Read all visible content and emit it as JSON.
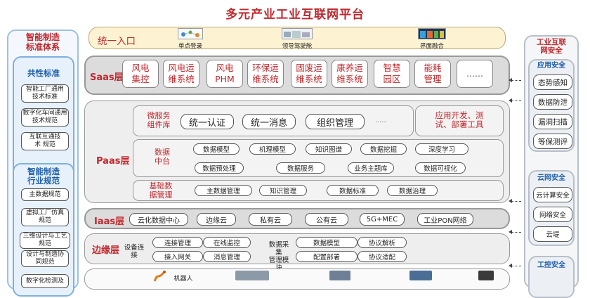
{
  "title": "多元产业工业互联网平台",
  "left": {
    "title": "智能制造\n标准体系",
    "groups": [
      {
        "title": "共性标准",
        "items": [
          "智能工厂通用\n技术标准",
          "数字化车间通用\n技术规范",
          "互联互通技\n术 规范"
        ]
      },
      {
        "title": "智能制造\n行业规范",
        "items": [
          "主数据规范",
          "虚拟工厂仿真\n规范",
          "三维设计与工艺\n规范",
          "设计与制造协\n同规范",
          "数字化检测及"
        ]
      }
    ]
  },
  "right": {
    "title": "工业互联\n网安全",
    "groups": [
      {
        "title": "应用安全",
        "items": [
          "态势感知",
          "数据防泄",
          "漏洞扫描",
          "等保测评"
        ]
      },
      {
        "title": "云网安全",
        "items": [
          "云计算安全",
          "网络安全",
          "云堤"
        ]
      },
      {
        "title": "工控安全",
        "items": []
      }
    ]
  },
  "entry": {
    "label": "统一入口",
    "items": [
      "单点登录",
      "领导驾驶舱",
      "界面融合"
    ]
  },
  "saas": {
    "label": "Saas层",
    "items": [
      "风电\n集控",
      "风电运\n维系统",
      "风电\nPHM",
      "环保运\n维系统",
      "固废运\n维系统",
      "康养运\n维系统",
      "智慧\n园区",
      "能耗\n管理",
      "......"
    ]
  },
  "paas": {
    "label": "Paas层",
    "micro": {
      "label": "微服务\n组件库",
      "items": [
        "统一认证",
        "统一消息",
        "组织管理",
        "......"
      ]
    },
    "app_dev": "应用开发、测\n试、部署工具",
    "data": {
      "label": "数据\n中台",
      "items": [
        "数据模型",
        "机理模型",
        "知识图谱",
        "数据挖掘",
        "深度学习",
        "数据预处理",
        "数据服务",
        "业务主题库",
        "数据可视化"
      ]
    },
    "master": {
      "label": "基础数\n据管理",
      "items": [
        "主数据管理",
        "知识管理",
        "数据标准",
        "数据治理"
      ]
    }
  },
  "iaas": {
    "label": "Iaas层",
    "items": [
      "云化数据中心",
      "边缘云",
      "私有云",
      "公有云",
      "5G+MEC",
      "工业PON网络"
    ]
  },
  "edge": {
    "label": "边缘层",
    "device_label": "设备连\n接",
    "device_items": [
      "连接管理",
      "在线监控",
      "接入网关",
      "消息管理"
    ],
    "data_label": "数据采\n集\n管理模\n块",
    "data_items": [
      "数据模型",
      "协议解析",
      "配置部署",
      "协议适配"
    ]
  },
  "bottom": {
    "robot_label": "机器人"
  }
}
